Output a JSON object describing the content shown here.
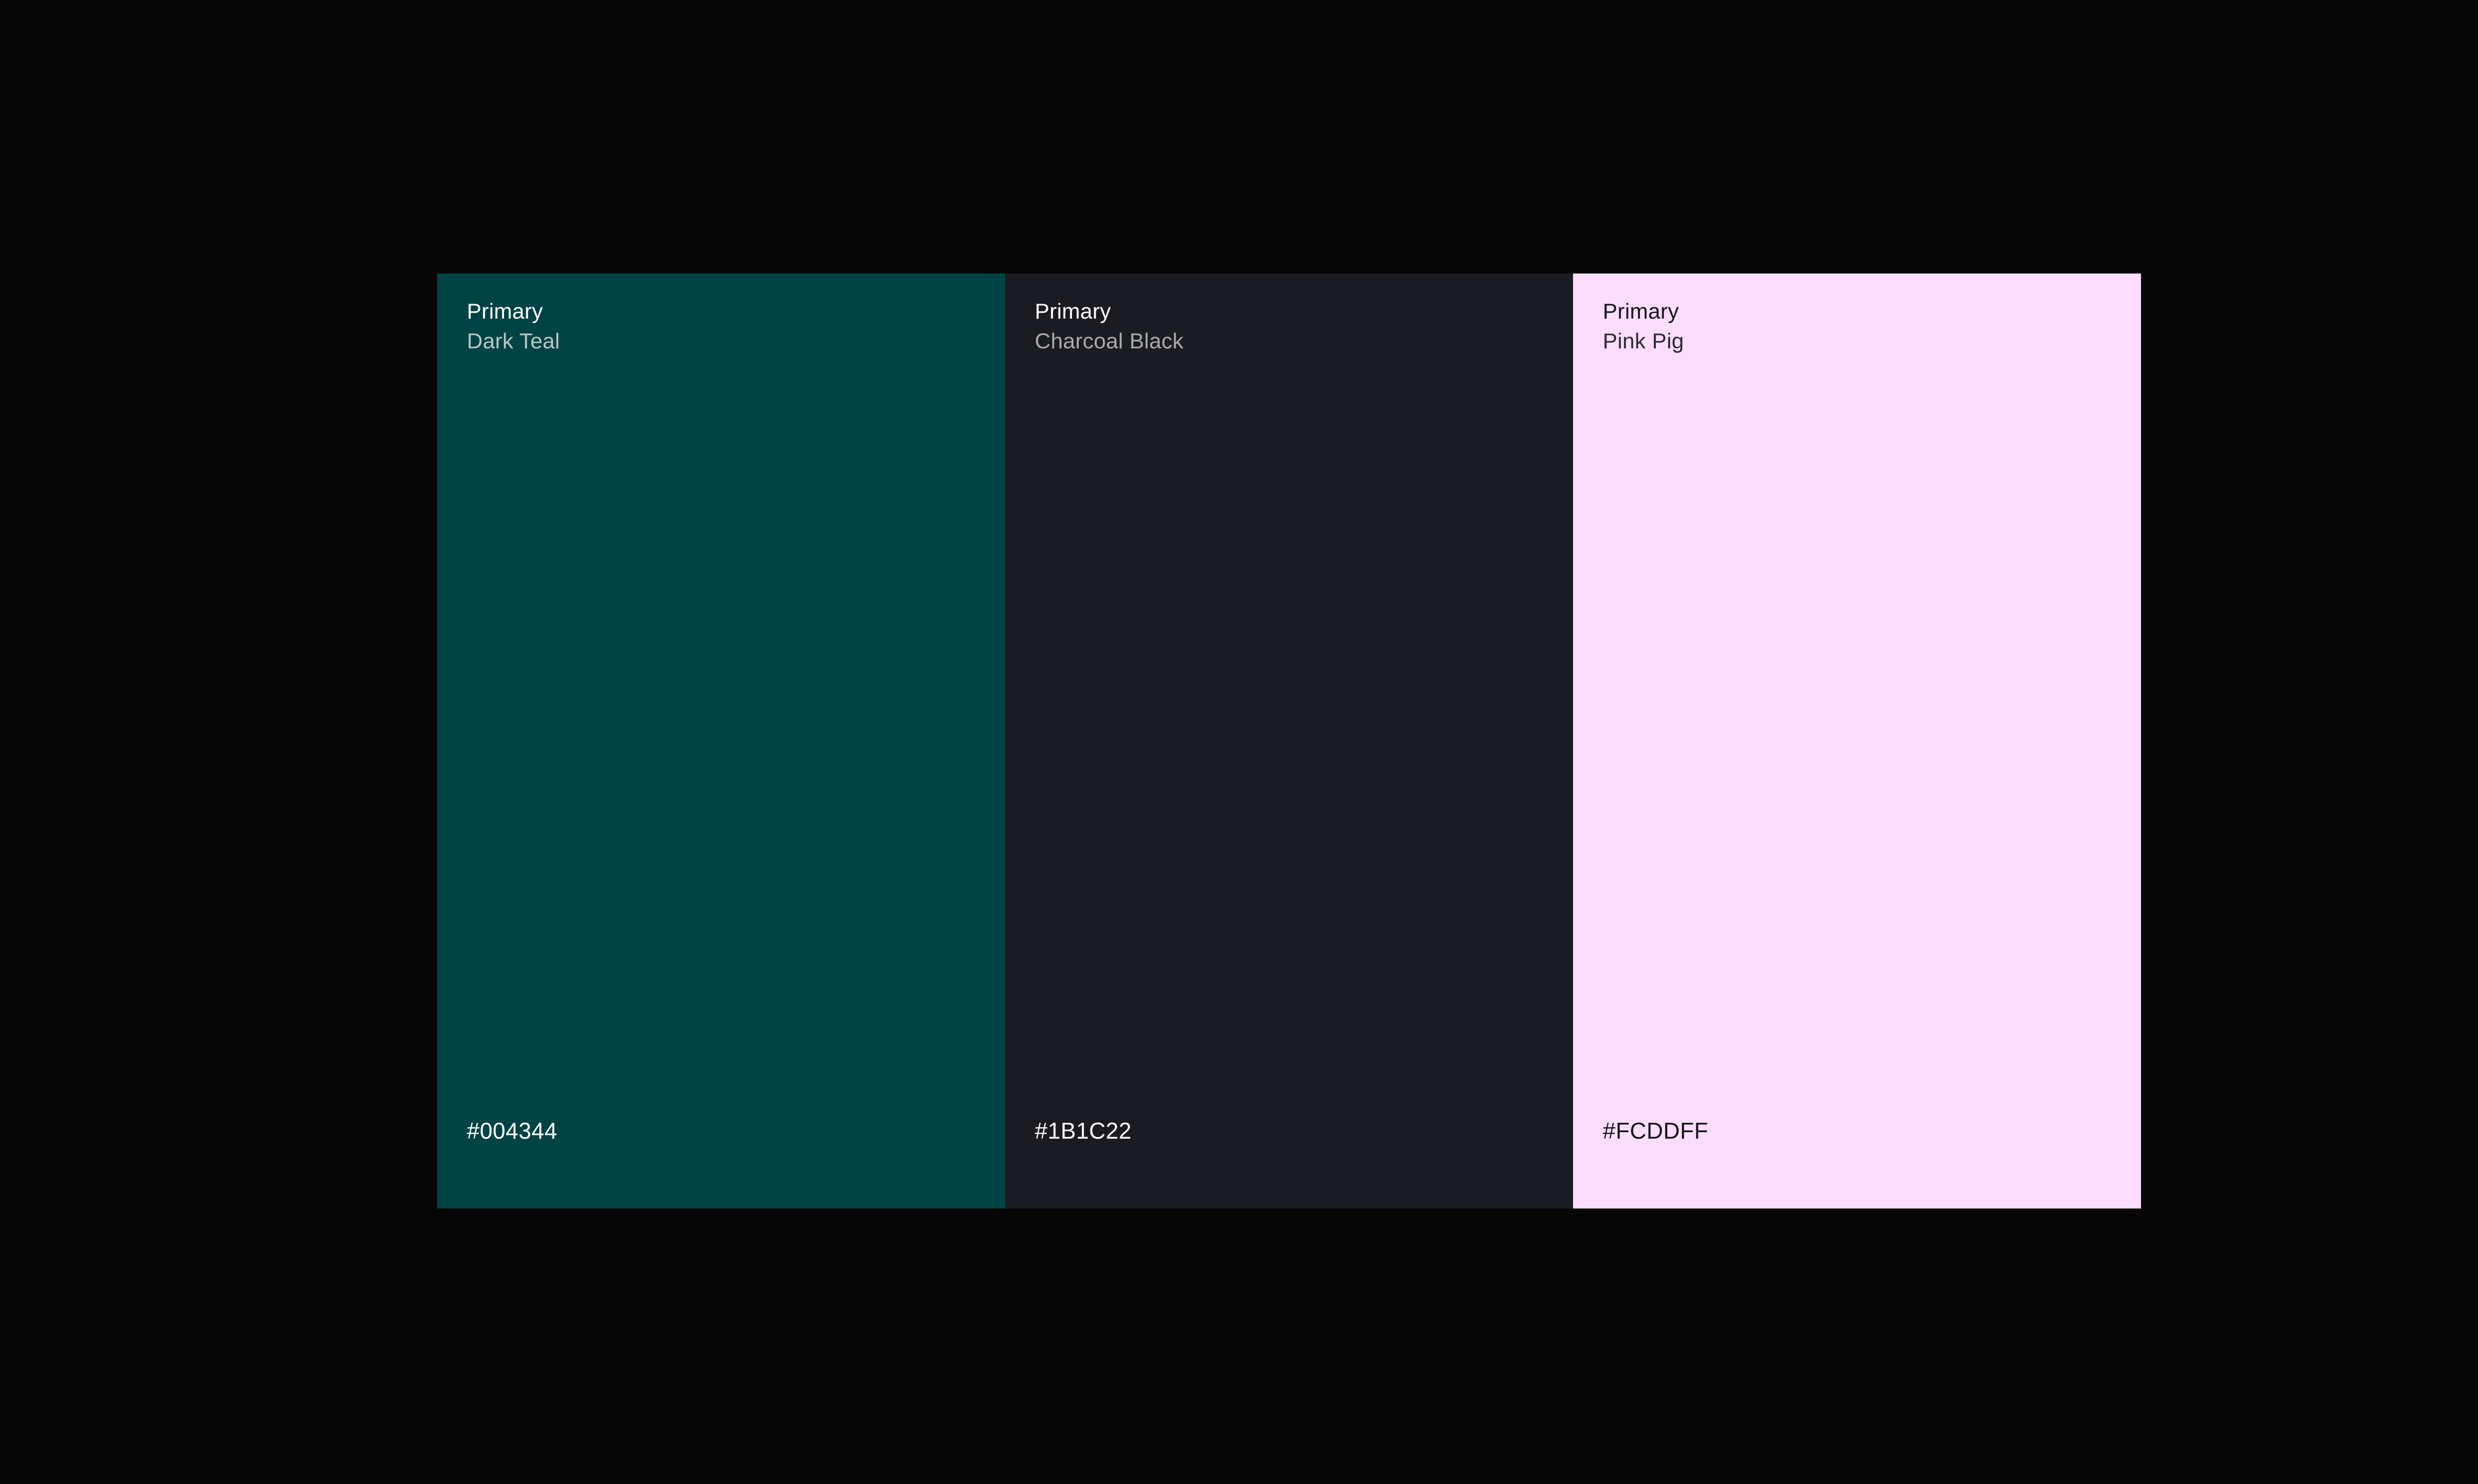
{
  "swatches": [
    {
      "category": "Primary",
      "name": "Dark Teal",
      "hex": "#004344",
      "background": "#004344",
      "text_color": "#ffffff",
      "name_color": "#b8c6c6"
    },
    {
      "category": "Primary",
      "name": "Charcoal Black",
      "hex": "#1B1C22",
      "background": "#1b1c22",
      "text_color": "#ffffff",
      "name_color": "#a9aaae"
    },
    {
      "category": "Primary",
      "name": "Pink Pig",
      "hex": "#FCDDFF",
      "background": "#fcddff",
      "text_color": "#15151a",
      "name_color": "#2a2a30"
    }
  ]
}
